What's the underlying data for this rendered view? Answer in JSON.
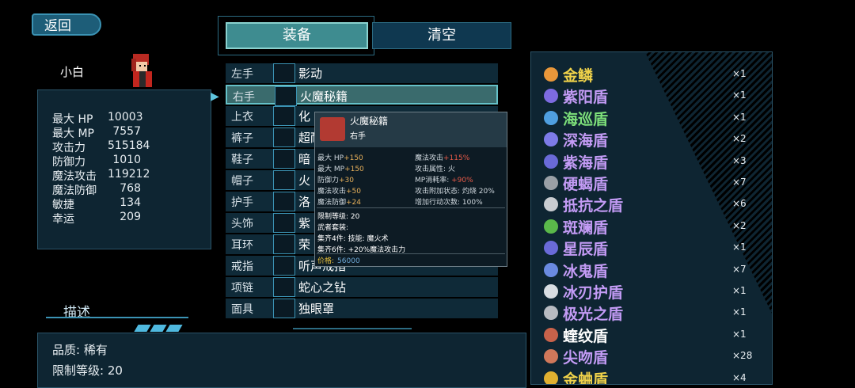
{
  "header": {
    "back_label": "返回",
    "tab_equip": "装备",
    "tab_clear": "清空"
  },
  "character": {
    "name": "小白",
    "stats": [
      {
        "label": "最大 HP",
        "value": "10003"
      },
      {
        "label": "最大 MP",
        "value": "7557"
      },
      {
        "label": "攻击力",
        "value": "515184"
      },
      {
        "label": "防御力",
        "value": "1010"
      },
      {
        "label": "魔法攻击",
        "value": "119212"
      },
      {
        "label": "魔法防御",
        "value": "768"
      },
      {
        "label": "敏捷",
        "value": "134"
      },
      {
        "label": "幸运",
        "value": "209"
      }
    ]
  },
  "equipment": {
    "slots": [
      {
        "slot": "左手",
        "item": "影动",
        "icon": "blade-icon"
      },
      {
        "slot": "右手",
        "item": "火魔秘籍",
        "icon": "red-book-icon"
      },
      {
        "slot": "上衣",
        "item": "化",
        "icon": "armor-icon"
      },
      {
        "slot": "裤子",
        "item": "超耐",
        "icon": "pants-icon"
      },
      {
        "slot": "鞋子",
        "item": "暗",
        "icon": "boots-icon"
      },
      {
        "slot": "帽子",
        "item": "火",
        "icon": "helmet-icon"
      },
      {
        "slot": "护手",
        "item": "洛",
        "icon": "gauntlet-icon"
      },
      {
        "slot": "头饰",
        "item": "紫",
        "icon": "circlet-icon"
      },
      {
        "slot": "耳环",
        "item": "荣",
        "icon": "earring-icon"
      },
      {
        "slot": "戒指",
        "item": "听声戒指",
        "icon": "ring-icon"
      },
      {
        "slot": "项链",
        "item": "蛇心之钻",
        "icon": "necklace-icon"
      },
      {
        "slot": "面具",
        "item": "独眼罩",
        "icon": "eyepatch-icon"
      }
    ]
  },
  "tooltip": {
    "name": "火魔秘籍",
    "slot": "右手",
    "attrs_left": [
      {
        "label": "最大 HP",
        "value": "+150"
      },
      {
        "label": "最大 MP",
        "value": "+150"
      },
      {
        "label": "防御力",
        "value": "+30"
      },
      {
        "label": "魔法攻击",
        "value": "+50"
      },
      {
        "label": "魔法防御",
        "value": "+24"
      }
    ],
    "attrs_right": [
      {
        "label": "魔法攻击",
        "value": "+115%"
      },
      {
        "label": "攻击属性: 火",
        "value": ""
      },
      {
        "label": "MP消耗率: ",
        "value": "+90%"
      },
      {
        "label": "攻击附加状态: 灼烧 20%",
        "value": ""
      },
      {
        "label": "增加行动次数: 100%",
        "value": ""
      }
    ],
    "lines": [
      "限制等级: 20",
      "武者套装:",
      "集齐4件: 技能: 魔火术",
      "集齐6件: +20%魔法攻击力"
    ],
    "price_label": "价格:",
    "price_value": "56000"
  },
  "inventory": {
    "items": [
      {
        "name": "金鳞",
        "qty": "×1",
        "color": "#f0d24a",
        "icon_color": "#e9973a"
      },
      {
        "name": "紫阳盾",
        "qty": "×1",
        "color": "#c39bf5",
        "icon_color": "#7d6be0"
      },
      {
        "name": "海巡盾",
        "qty": "×1",
        "color": "#7de07a",
        "icon_color": "#4f9fe0"
      },
      {
        "name": "深海盾",
        "qty": "×2",
        "color": "#c39bf5",
        "icon_color": "#7d7be8"
      },
      {
        "name": "紫海盾",
        "qty": "×3",
        "color": "#c39bf5",
        "icon_color": "#6a6ad8"
      },
      {
        "name": "硬蝎盾",
        "qty": "×7",
        "color": "#c39bf5",
        "icon_color": "#9aa0a6"
      },
      {
        "name": "抵抗之盾",
        "qty": "×6",
        "color": "#c39bf5",
        "icon_color": "#c8ccd0"
      },
      {
        "name": "斑斓盾",
        "qty": "×2",
        "color": "#c39bf5",
        "icon_color": "#5ab84a"
      },
      {
        "name": "星辰盾",
        "qty": "×1",
        "color": "#c39bf5",
        "icon_color": "#6a6ad8"
      },
      {
        "name": "冰鬼盾",
        "qty": "×7",
        "color": "#c39bf5",
        "icon_color": "#6a8ae0"
      },
      {
        "name": "冰刃护盾",
        "qty": "×1",
        "color": "#c39bf5",
        "icon_color": "#d8dde2"
      },
      {
        "name": "极光之盾",
        "qty": "×1",
        "color": "#c39bf5",
        "icon_color": "#b8bcc2"
      },
      {
        "name": "蝰纹盾",
        "qty": "×1",
        "color": "#ffffff",
        "icon_color": "#c8624a"
      },
      {
        "name": "尖吻盾",
        "qty": "×28",
        "color": "#c39bf5",
        "icon_color": "#d0785a"
      },
      {
        "name": "金蛐盾",
        "qty": "×4",
        "color": "#f0d24a",
        "icon_color": "#e0b030"
      }
    ]
  },
  "description": {
    "title": "描述",
    "lines": [
      "品质: 稀有",
      "限制等级: 20"
    ]
  }
}
